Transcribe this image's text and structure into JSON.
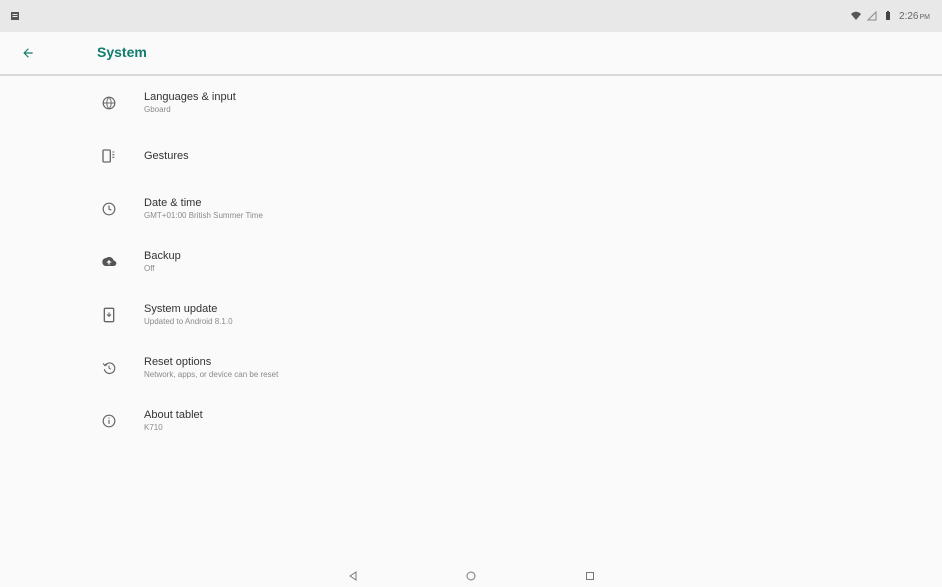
{
  "status_bar": {
    "time": "2:26",
    "am_pm": "PM",
    "icons": [
      "notification-icon",
      "wifi-icon",
      "signal-icon",
      "battery-icon"
    ]
  },
  "app_bar": {
    "title": "System",
    "back_icon": "arrow-back-icon",
    "accent_color": "#0f7d6d"
  },
  "items": [
    {
      "icon": "globe-icon",
      "title": "Languages & input",
      "subtitle": "Gboard"
    },
    {
      "icon": "gestures-icon",
      "title": "Gestures",
      "subtitle": ""
    },
    {
      "icon": "clock-icon",
      "title": "Date & time",
      "subtitle": "GMT+01:00 British Summer Time"
    },
    {
      "icon": "cloud-upload-icon",
      "title": "Backup",
      "subtitle": "Off"
    },
    {
      "icon": "system-update-icon",
      "title": "System update",
      "subtitle": "Updated to Android 8.1.0"
    },
    {
      "icon": "reset-icon",
      "title": "Reset options",
      "subtitle": "Network, apps, or device can be reset"
    },
    {
      "icon": "info-icon",
      "title": "About tablet",
      "subtitle": "K710"
    }
  ],
  "nav": {
    "icons": [
      "back-icon",
      "home-icon",
      "recents-icon"
    ]
  }
}
